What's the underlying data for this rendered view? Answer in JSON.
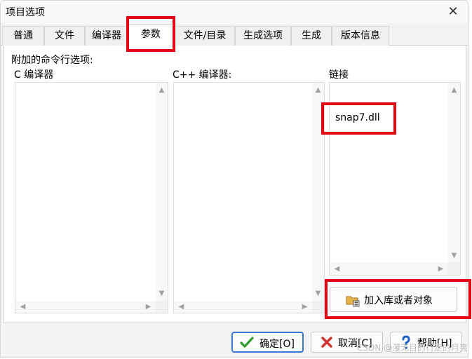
{
  "window": {
    "title": "项目选项",
    "close_glyph": "✕"
  },
  "tabs": [
    {
      "label": "普通"
    },
    {
      "label": "文件"
    },
    {
      "label": "编译器"
    },
    {
      "label": "参数",
      "active": true
    },
    {
      "label": "文件/目录"
    },
    {
      "label": "生成选项"
    },
    {
      "label": "生成"
    },
    {
      "label": "版本信息"
    }
  ],
  "panel": {
    "heading": "附加的命令行选项:",
    "c_compiler": {
      "label": "C 编译器",
      "items": []
    },
    "cpp_compiler": {
      "label": "C++ 编译器:",
      "items": []
    },
    "linker": {
      "label": "链接",
      "items": [
        "snap7.dll"
      ]
    },
    "add_library_button": {
      "label": "加入库或者对象",
      "icon": "folder-add-icon"
    }
  },
  "footer": {
    "ok_button": "确定[O]",
    "cancel_button": "取消[C]",
    "help_button": "帮助[H]"
  },
  "watermark": "CSDN @漫无目的行走的月亮",
  "colors": {
    "highlight": "#e30613",
    "default_button_border": "#3a78d6",
    "check": "#2e9b2e",
    "cancel_x": "#d0312d",
    "help": "#1f5fbf"
  }
}
